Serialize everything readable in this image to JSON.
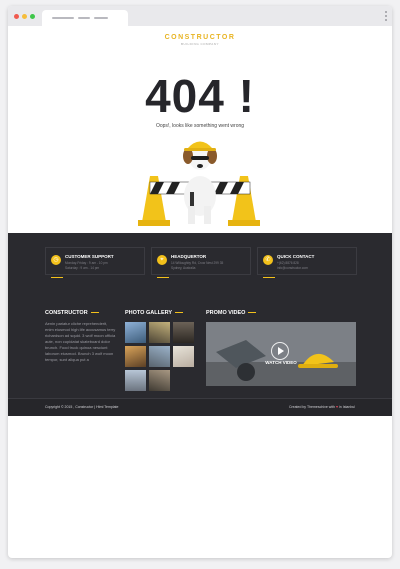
{
  "browser": {
    "dot_colors": [
      "#f05a4f",
      "#f6bd3b",
      "#3fc64a"
    ]
  },
  "logo": {
    "name": "CONSTRUCTOR",
    "tagline": "BUILDING COMPANY"
  },
  "error": {
    "code": "404 !",
    "message": "Oops!, looks like something went wrong"
  },
  "info_cards": [
    {
      "icon": "clock-icon",
      "title": "CUSTOMER SUPPORT",
      "lines": [
        "Monday-Friday : 9 am - 10 pm",
        "Saturday : 9 am - 14 pm"
      ]
    },
    {
      "icon": "location-pin-icon",
      "title": "HEADQUERTOR",
      "lines": [
        "14 Willoughby Rd, Crow Nest 299 35",
        "Sydney, Australia"
      ]
    },
    {
      "icon": "phone-icon",
      "title": "QUICK CONTACT",
      "lines": [
        "+(62) 8876 828",
        "info@constructor.com"
      ]
    }
  ],
  "footer": {
    "about_title": "CONSTRUCTOR",
    "about_text": "Aenin pariatur cliche reprehenderit, enim eiusmod high life accusamus terry richardson ad squid. 3 wolf moon officia aute, non cupidatat skateboard dolor brunch. Food truck quinoa nesciunt laborum eiusmod. Brunch 3 wolf moon tempor, sunt aliqua put a",
    "gallery_title": "PHOTO GALLERY",
    "video_title": "PROMO VIDEO",
    "video_label": "WATCH VIDEO"
  },
  "bottom": {
    "copyright": "Copyright © 2015 , Constructor | Html Template",
    "credit_prefix": "Created by Themeschive with",
    "credit_suffix": "in Istanbul"
  },
  "colors": {
    "accent": "#f3c11b",
    "dark": "#2a2a2f"
  }
}
